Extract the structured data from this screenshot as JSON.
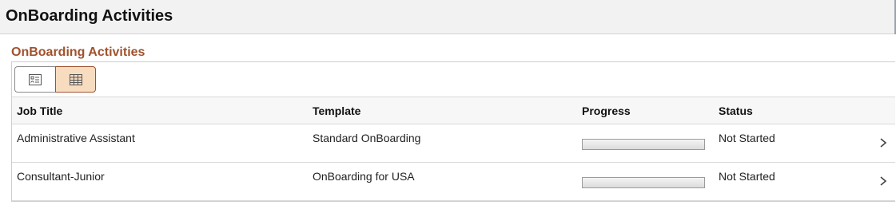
{
  "page": {
    "title": "OnBoarding Activities"
  },
  "group": {
    "title": "OnBoarding Activities",
    "view_toggle": [
      {
        "icon": "list-view-icon",
        "selected": false
      },
      {
        "icon": "grid-view-icon",
        "selected": true
      }
    ]
  },
  "table": {
    "columns": [
      "Job Title",
      "Template",
      "Progress",
      "Status"
    ],
    "rows": [
      {
        "job_title": "Administrative Assistant",
        "template": "Standard OnBoarding",
        "progress": 0,
        "status": "Not Started",
        "icon": "chevron-right-icon"
      },
      {
        "job_title": "Consultant-Junior",
        "template": "OnBoarding for USA",
        "progress": 0,
        "status": "Not Started",
        "icon": "chevron-right-icon"
      }
    ]
  },
  "colors": {
    "accent": "#a0522d",
    "selected_toggle_bg": "#f8dcc0",
    "header_bg": "#f2f2f2"
  }
}
